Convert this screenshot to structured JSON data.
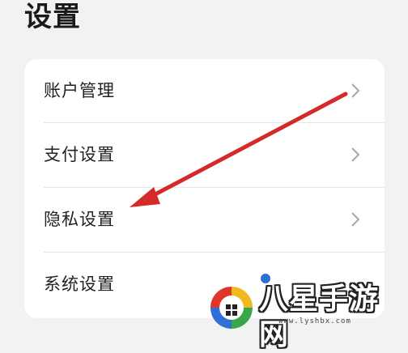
{
  "page": {
    "title": "设置"
  },
  "settings": {
    "items": [
      {
        "label": "账户管理",
        "icon": "chevron-right-icon"
      },
      {
        "label": "支付设置",
        "icon": "chevron-right-icon"
      },
      {
        "label": "隐私设置",
        "icon": "chevron-right-icon"
      },
      {
        "label": "系统设置",
        "icon": "chevron-right-icon"
      }
    ]
  },
  "annotation": {
    "arrow_color": "#d42a2a",
    "points_to": "隐私设置"
  },
  "watermark": {
    "text": "八星手游网",
    "url": "www.lyshbx.com"
  },
  "colors": {
    "background": "#f2f2f2",
    "card": "#ffffff",
    "chevron": "#a8a8a8",
    "text": "#222222"
  }
}
